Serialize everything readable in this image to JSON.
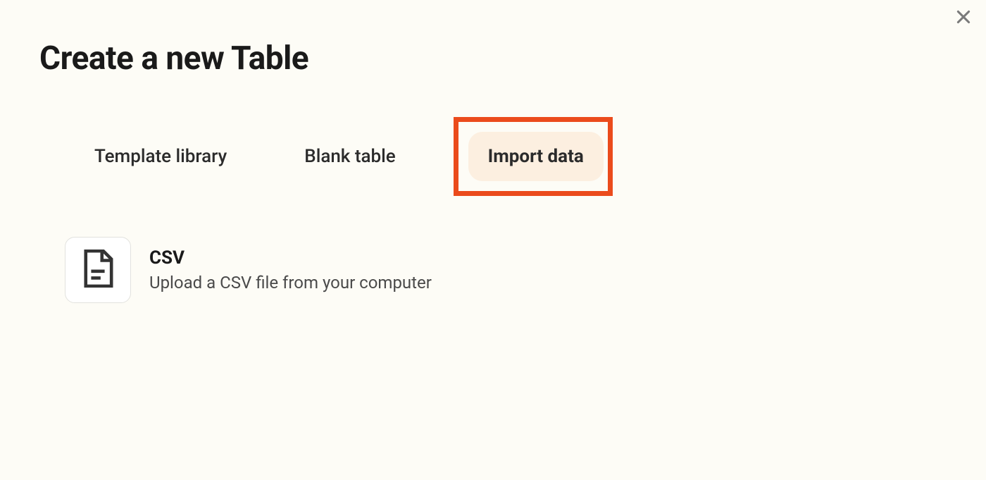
{
  "modal": {
    "title": "Create a new Table"
  },
  "tabs": {
    "template_library": "Template library",
    "blank_table": "Blank table",
    "import_data": "Import data"
  },
  "options": {
    "csv": {
      "title": "CSV",
      "description": "Upload a CSV file from your computer"
    }
  }
}
